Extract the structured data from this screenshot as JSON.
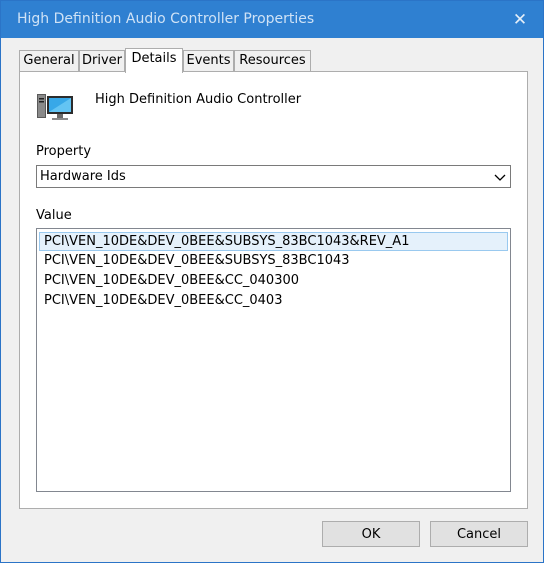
{
  "window": {
    "title": "High Definition Audio Controller Properties",
    "close_glyph": "✕"
  },
  "tabs": [
    {
      "label": "General",
      "active": false
    },
    {
      "label": "Driver",
      "active": false
    },
    {
      "label": "Details",
      "active": true
    },
    {
      "label": "Events",
      "active": false
    },
    {
      "label": "Resources",
      "active": false
    }
  ],
  "details": {
    "device_icon": "computer-device-icon",
    "device_name": "High Definition Audio Controller",
    "property_label": "Property",
    "property_selected": "Hardware Ids",
    "value_label": "Value",
    "values": [
      "PCI\\VEN_10DE&DEV_0BEE&SUBSYS_83BC1043&REV_A1",
      "PCI\\VEN_10DE&DEV_0BEE&SUBSYS_83BC1043",
      "PCI\\VEN_10DE&DEV_0BEE&CC_040300",
      "PCI\\VEN_10DE&DEV_0BEE&CC_0403"
    ],
    "selected_index": 0
  },
  "buttons": {
    "ok": "OK",
    "cancel": "Cancel"
  },
  "colors": {
    "titlebar": "#2f80d1",
    "selection": "#e5f1fb"
  }
}
